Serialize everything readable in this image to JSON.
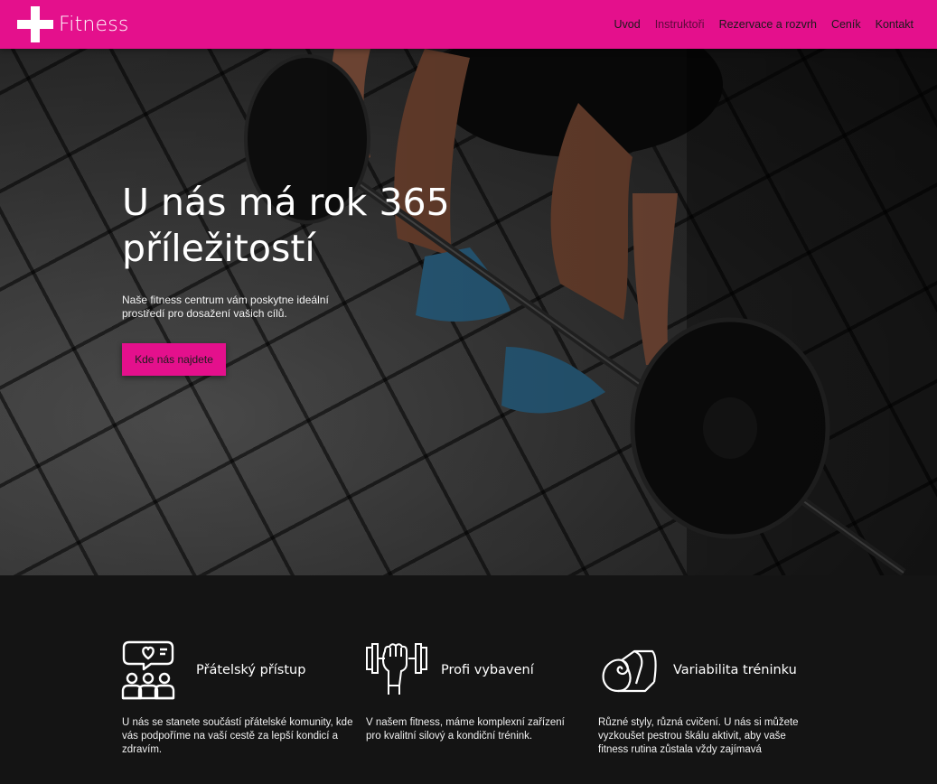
{
  "header": {
    "logo_text": "Fitness",
    "nav": [
      "Uvod",
      "Instruktoři",
      "Rezervace a rozvrh",
      "Ceník",
      "Kontakt"
    ]
  },
  "hero": {
    "title_line1": "U nás má rok 365",
    "title_line2": "příležitostí",
    "description": "Naše fitness centrum vám poskytne ideální prostředí pro dosažení vašich cílů.",
    "button_label": "Kde nás najdete"
  },
  "features": [
    {
      "icon": "community-icon",
      "title": "Přátelský přístup",
      "text": "U nás se stanete součástí přátelské komunity, kde vás podpoříme na vaší cestě za lepší kondicí a zdravím."
    },
    {
      "icon": "dumbbell-fist-icon",
      "title": "Profi vybavení",
      "text": "V našem fitness, máme komplexní zařízení pro kvalitní silový a kondiční trénink."
    },
    {
      "icon": "yoga-mat-icon",
      "title": "Variabilita tréninku",
      "text": "Různé styly, různá cvičení. U nás si můžete vyzkoušet pestrou škálu aktivit, aby vaše fitness rutina zůstala vždy zajímavá"
    }
  ],
  "colors": {
    "accent": "#e4108c",
    "background": "#141414"
  }
}
